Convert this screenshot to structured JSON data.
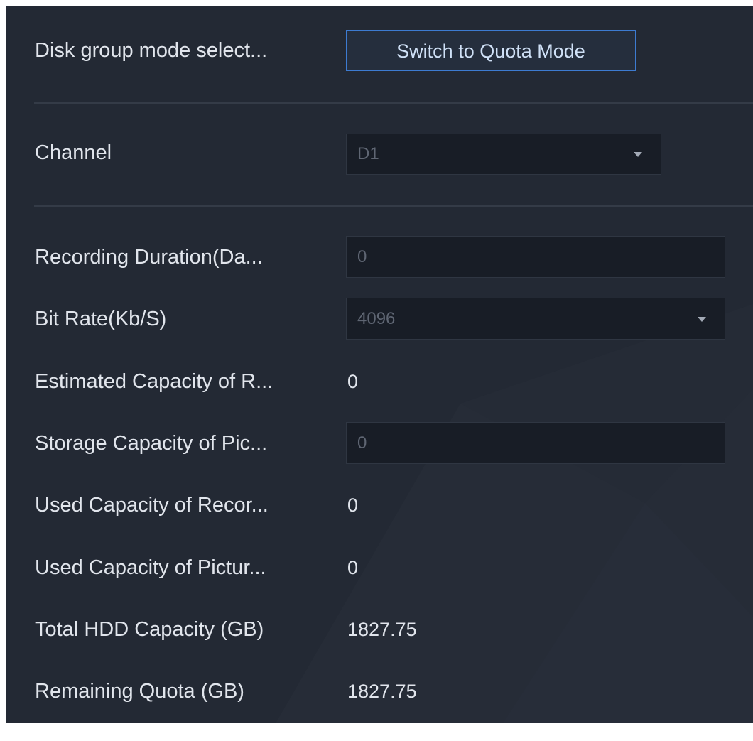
{
  "disk_group": {
    "label": "Disk group mode select...",
    "button": "Switch to Quota Mode"
  },
  "channel": {
    "label": "Channel",
    "value": "D1"
  },
  "fields": {
    "recording_duration": {
      "label": "Recording Duration(Da...",
      "value": "0"
    },
    "bit_rate": {
      "label": "Bit Rate(Kb/S)",
      "value": "4096"
    },
    "estimated_capacity": {
      "label": "Estimated Capacity of R...",
      "value": "0"
    },
    "storage_capacity_pic": {
      "label": "Storage Capacity of Pic...",
      "value": "0"
    },
    "used_capacity_record": {
      "label": "Used Capacity of Recor...",
      "value": "0"
    },
    "used_capacity_picture": {
      "label": "Used Capacity of Pictur...",
      "value": "0"
    },
    "total_hdd": {
      "label": "Total HDD Capacity (GB)",
      "value": "1827.75"
    },
    "remaining_quota": {
      "label": "Remaining Quota (GB)",
      "value": "1827.75"
    }
  },
  "icons": {
    "dropdown": "chevron-down-icon"
  },
  "colors": {
    "background": "#232934",
    "accent_border": "#3d7bd1",
    "field_bg": "#181d26",
    "text": "#e1e5ec",
    "disabled_text": "#5f6673"
  }
}
